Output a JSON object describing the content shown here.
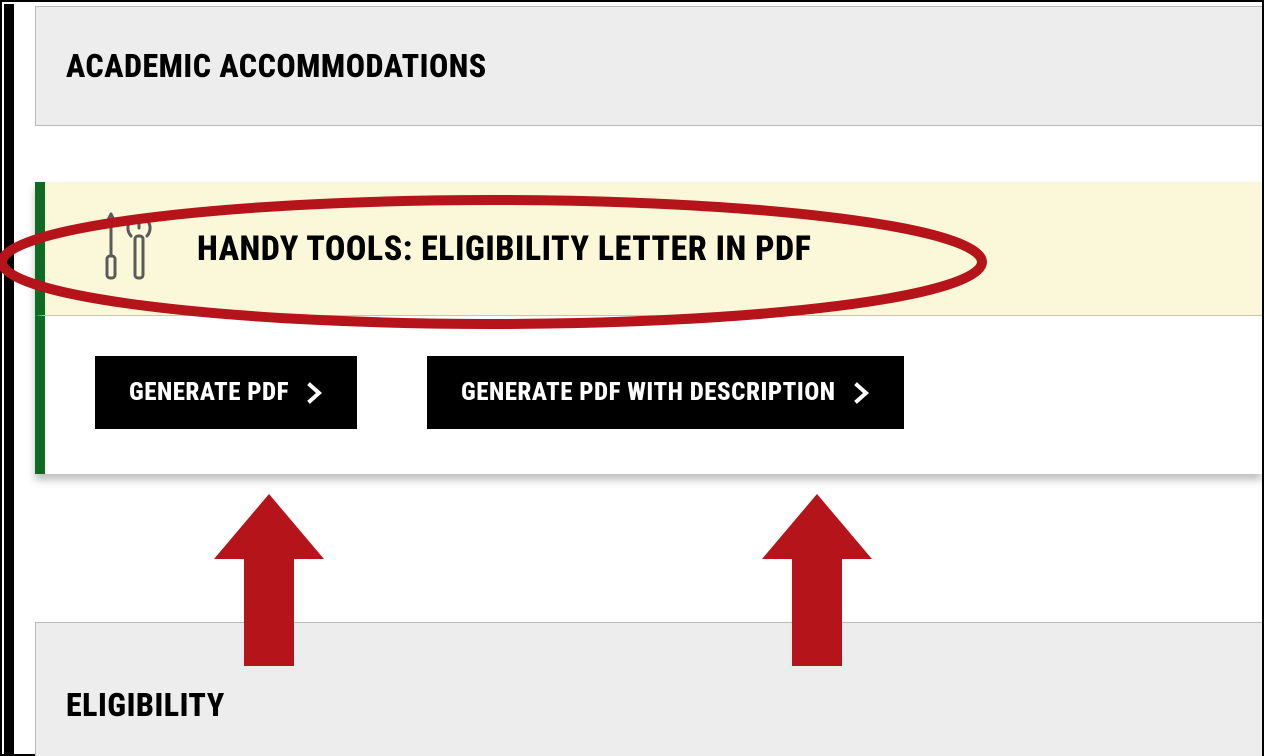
{
  "panels": {
    "academic_accommodations_title": "ACADEMIC ACCOMMODATIONS",
    "eligibility_title": "ELIGIBILITY"
  },
  "handy_tools": {
    "title": "HANDY TOOLS: ELIGIBILITY LETTER IN PDF",
    "icon_name": "tools-icon",
    "buttons": {
      "generate_pdf": "GENERATE PDF",
      "generate_pdf_desc": "GENERATE PDF WITH DESCRIPTION"
    }
  },
  "annotations": {
    "ellipse_color": "#b4141a",
    "arrow_color": "#b4141a"
  }
}
